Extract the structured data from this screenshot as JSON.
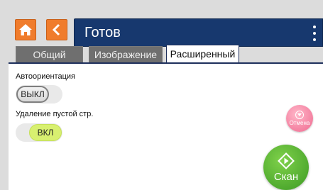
{
  "header": {
    "home_icon": "home-icon",
    "back_icon": "chevron-left-icon",
    "title": "Готов",
    "menu_icon": "kebab-menu-icon"
  },
  "tabs": [
    {
      "label": "Общий",
      "active": false
    },
    {
      "label": "Изображение",
      "active": false
    },
    {
      "label": "Расширенный",
      "active": true
    }
  ],
  "settings": {
    "auto_orientation": {
      "label": "Автоориентация",
      "value": "ВЫКЛ",
      "enabled": false
    },
    "blank_page_removal": {
      "label": "Удаление пустой стр.",
      "value": "ВКЛ",
      "enabled": true
    }
  },
  "actions": {
    "cancel_label": "Отмена",
    "scan_label": "Скан"
  },
  "colors": {
    "accent_orange": "#f07c2c",
    "title_bar": "#17386e",
    "toggle_on": "#d8f070",
    "cancel": "#ef6a90",
    "scan": "#3c9a24"
  }
}
